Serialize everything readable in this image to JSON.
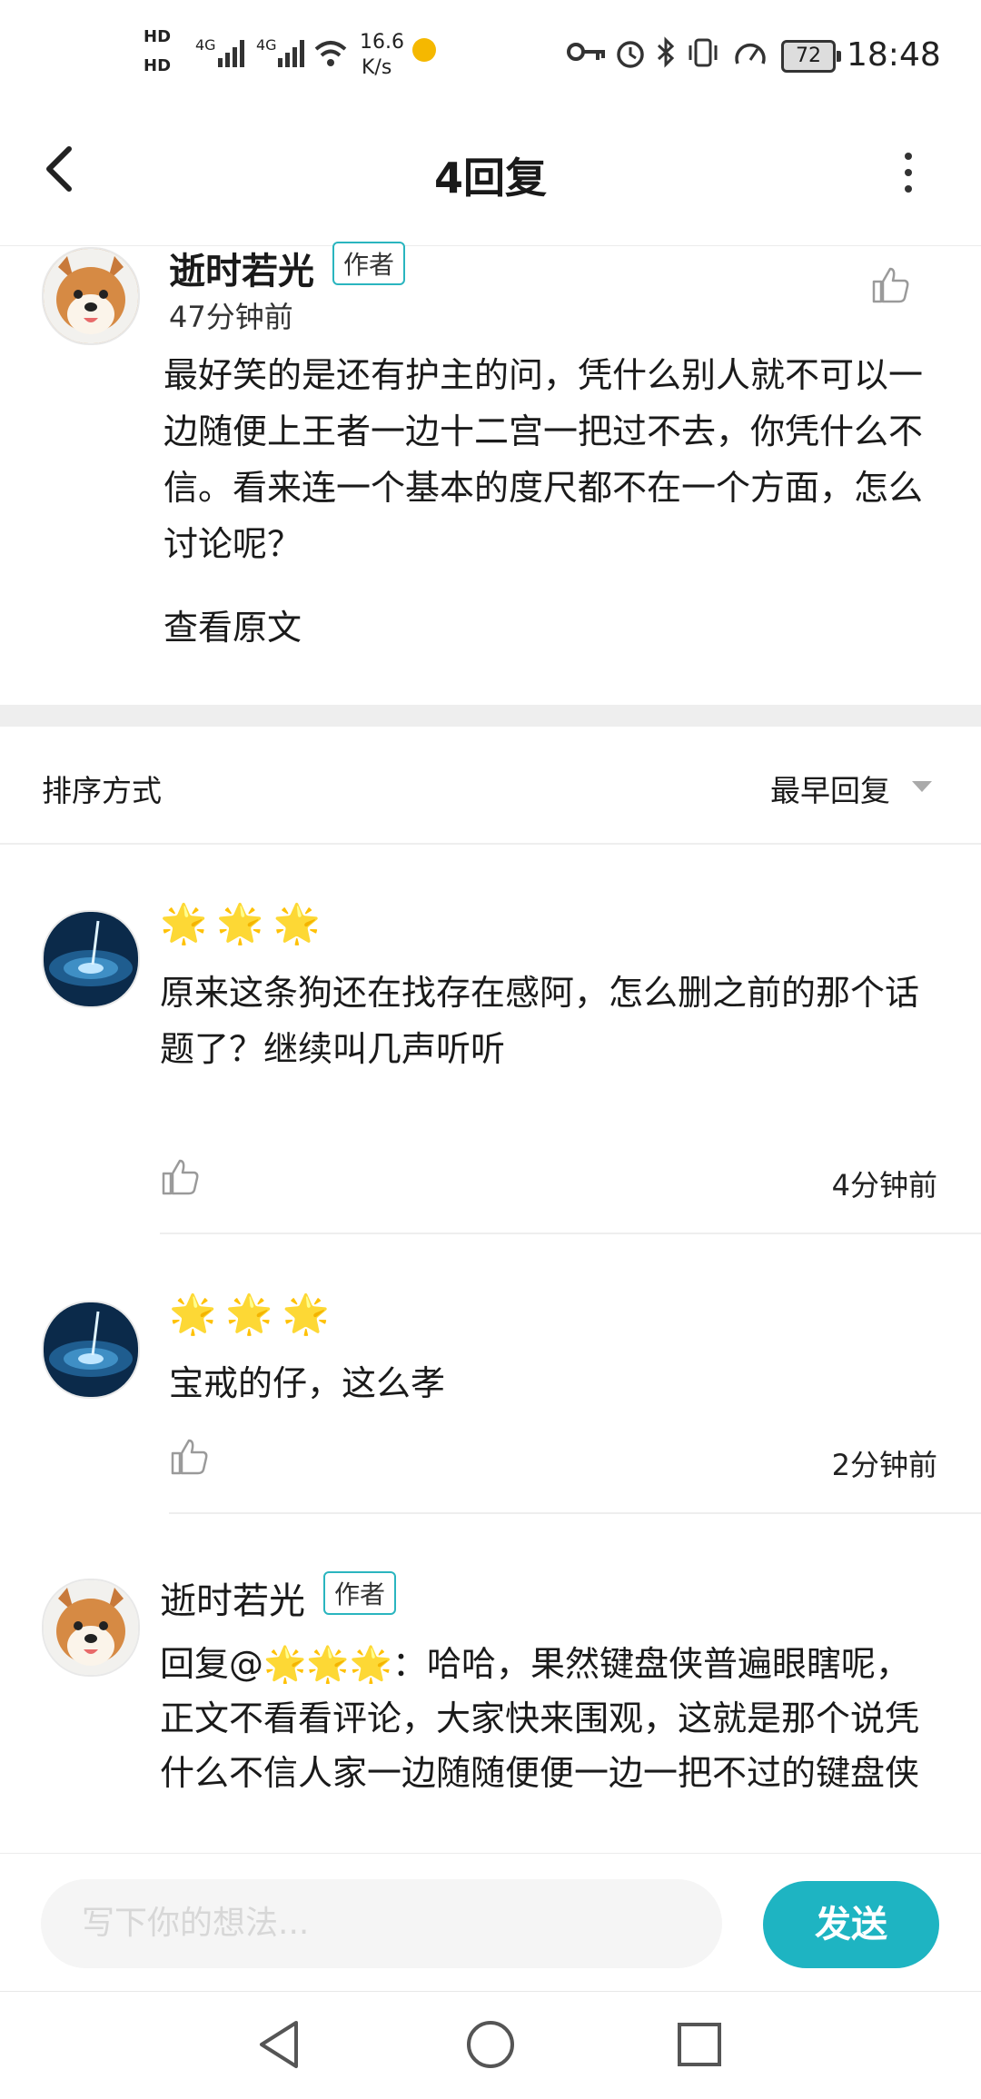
{
  "status_bar": {
    "hd1": "HD",
    "hd2": "HD",
    "net1": "4G",
    "net2": "4G",
    "speed_value": "16.6",
    "speed_unit": "K/s",
    "battery": "72",
    "time": "18:48"
  },
  "header": {
    "title": "4回复"
  },
  "main_post": {
    "author": "逝时若光",
    "badge": "作者",
    "time": "47分钟前",
    "content": "最好笑的是还有护主的问，凭什么别人就不可以一边随便上王者一边十二宫一把过不去，你凭什么不信。看来连一个基本的度尺都不在一个方面，怎么讨论呢？",
    "view_original": "查看原文"
  },
  "sort": {
    "label": "排序方式",
    "value": "最早回复"
  },
  "replies": [
    {
      "name": "🌟🌟🌟",
      "content": "原来这条狗还在找存在感阿，怎么删之前的那个话题了？继续叫几声听听",
      "time": "4分钟前"
    },
    {
      "name": "🌟🌟🌟",
      "content": "宝戒的仔，这么孝",
      "time": "2分钟前"
    },
    {
      "name": "逝时若光",
      "badge": "作者",
      "content": "回复@🌟🌟🌟：哈哈，果然键盘侠普遍眼瞎呢，正文不看看评论，大家快来围观，这就是那个说凭什么不信人家一边随随便便一边一把不过的键盘侠"
    }
  ],
  "input_bar": {
    "placeholder": "写下你的想法...",
    "send": "发送"
  },
  "colors": {
    "accent": "#1eb4c2",
    "badge_border": "#2ab5bf",
    "divider": "#eeeeee"
  }
}
